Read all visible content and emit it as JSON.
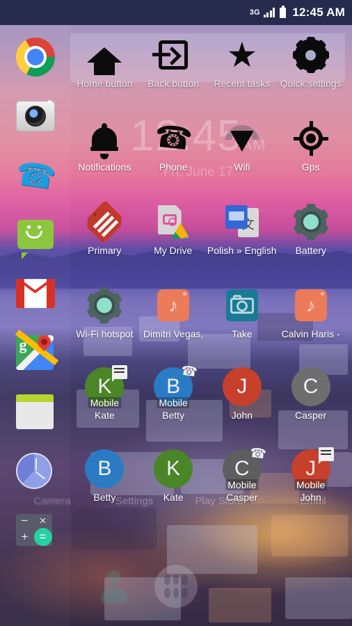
{
  "status_bar": {
    "network": "3G",
    "signal_icon": "signal-bars-icon",
    "battery_icon": "battery-icon",
    "time": "12:45 AM"
  },
  "clock_widget": {
    "time": "12:45",
    "ampm": "AM",
    "date": "Fri, June 17"
  },
  "sidebar": {
    "items": [
      {
        "name": "chrome",
        "label": "Chrome",
        "icon": "chrome-icon"
      },
      {
        "name": "camera",
        "label": "Camera",
        "icon": "camera-icon"
      },
      {
        "name": "phone",
        "label": "Phone",
        "icon": "phone-icon"
      },
      {
        "name": "messaging",
        "label": "Messaging",
        "icon": "messaging-icon"
      },
      {
        "name": "gmail",
        "label": "Gmail",
        "icon": "gmail-icon"
      },
      {
        "name": "maps",
        "label": "Maps",
        "icon": "maps-icon"
      },
      {
        "name": "calendar",
        "label": "Calendar",
        "icon": "calendar-icon"
      },
      {
        "name": "clock",
        "label": "Clock",
        "icon": "clock-icon"
      },
      {
        "name": "calculator",
        "label": "Calculator",
        "icon": "calculator-icon"
      }
    ],
    "calculator_keys": {
      "minus": "−",
      "times": "×",
      "plus": "+",
      "equals": "="
    }
  },
  "shortcuts": {
    "rows": [
      {
        "row": 1,
        "items": [
          {
            "label": "Home button",
            "icon": "home-icon"
          },
          {
            "label": "Back button",
            "icon": "back-arrow-box-icon"
          },
          {
            "label": "Recent tasks",
            "icon": "star-icon"
          },
          {
            "label": "Quick settings",
            "icon": "gear-icon"
          }
        ]
      },
      {
        "row": 2,
        "items": [
          {
            "label": "Notifications",
            "icon": "bell-icon"
          },
          {
            "label": "Phone",
            "icon": "phone-handset-icon"
          },
          {
            "label": "Wifi",
            "icon": "wifi-icon"
          },
          {
            "label": "Gps",
            "icon": "gps-crosshair-icon"
          }
        ]
      },
      {
        "row": 3,
        "items": [
          {
            "label": "Primary",
            "icon": "gmail-label-tag-icon"
          },
          {
            "label": "My Drive",
            "icon": "drive-photo-icon"
          },
          {
            "label": "Polish » English",
            "icon": "translate-icon"
          },
          {
            "label": "Battery",
            "icon": "settings-gear-icon"
          }
        ]
      },
      {
        "row": 4,
        "items": [
          {
            "label": "Wi-Fi hotspot",
            "icon": "settings-gear-icon"
          },
          {
            "label": "Dimitri Vegas,",
            "icon": "music-note-icon"
          },
          {
            "label": "Take",
            "icon": "camera-shortcut-icon"
          },
          {
            "label": "Calvin Haris -",
            "icon": "music-note-icon"
          }
        ]
      },
      {
        "row": 5,
        "items": [
          {
            "label": "Kate",
            "initial": "K",
            "color": "#4a8527",
            "sub": "Mobile",
            "badge": "message-badge-icon"
          },
          {
            "label": "Betty",
            "initial": "B",
            "color": "#2a7bc4",
            "sub": "Mobile",
            "badge": "call-badge-icon"
          },
          {
            "label": "John",
            "initial": "J",
            "color": "#c7402c",
            "sub": "",
            "badge": ""
          },
          {
            "label": "Casper",
            "initial": "C",
            "color": "#6e6e6e",
            "sub": "",
            "badge": ""
          }
        ]
      },
      {
        "row": 6,
        "items": [
          {
            "label": "Betty",
            "initial": "B",
            "color": "#2a7bc4",
            "sub": "",
            "badge": ""
          },
          {
            "label": "Kate",
            "initial": "K",
            "color": "#4a8527",
            "sub": "",
            "badge": ""
          },
          {
            "label": "Casper",
            "initial": "C",
            "color": "#5e5e5e",
            "sub": "Mobile",
            "badge": "call-badge-icon"
          },
          {
            "label": "John",
            "initial": "J",
            "color": "#c7402c",
            "sub": "Mobile",
            "badge": "message-badge-icon"
          }
        ]
      }
    ]
  },
  "home_ghost_labels": [
    {
      "label": "Camera"
    },
    {
      "label": "Settings"
    },
    {
      "label": "Play Store"
    },
    {
      "label": "Email"
    }
  ],
  "dock": {
    "items": [
      {
        "label": "Contacts",
        "icon": "person-icon"
      },
      {
        "label": "All apps",
        "icon": "app-drawer-icon"
      }
    ]
  },
  "colors": {
    "status_bar": "#262a4c",
    "accent_green": "#4a8527",
    "accent_blue": "#2a7bc4",
    "accent_red": "#c7402c",
    "accent_gray": "#6e6e6e"
  }
}
